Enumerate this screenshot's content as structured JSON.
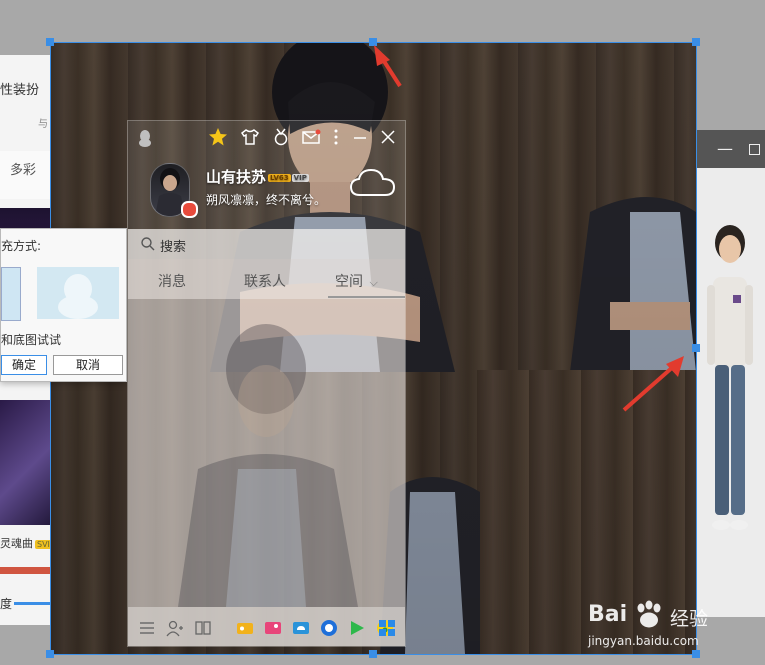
{
  "left_window": {
    "title": "性装扮",
    "small_text": "与",
    "tab": "多彩",
    "song_title": "灵魂曲",
    "song_badge": "SVI",
    "slider_label": "度"
  },
  "dialog": {
    "fill_label": "充方式:",
    "hint": "和底图试试",
    "ok_label": "确定",
    "cancel_label": "取消"
  },
  "right_window": {
    "minimize_glyph": "—"
  },
  "qq_panel": {
    "nickname": "山有扶苏",
    "level_badge": "LV63",
    "vip_badge": "VIP",
    "signature": "朔风凛凛，终不离兮。",
    "search_placeholder": "搜索",
    "tabs": [
      {
        "label": "消息"
      },
      {
        "label": "联系人"
      },
      {
        "label": "空间"
      }
    ],
    "tab_chevron": "⌵"
  },
  "watermark": {
    "brand": "Bai",
    "brand2": "经验",
    "url": "jingyan.baidu.com"
  },
  "colors": {
    "selection_blue": "#3a8ee6",
    "arrow_red": "#e23b2e",
    "status_red": "#e84b3c"
  }
}
